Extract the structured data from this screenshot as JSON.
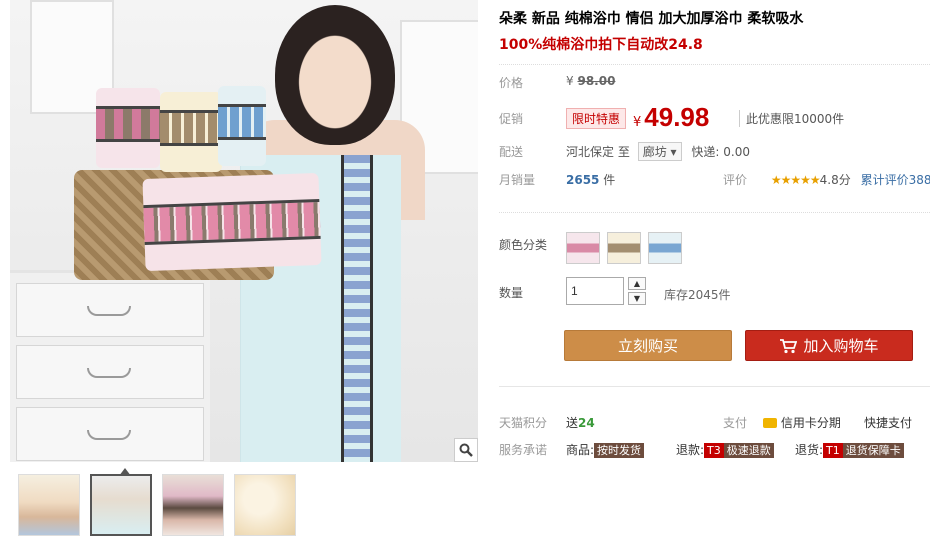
{
  "product": {
    "title": "朵柔 新品 纯棉浴巾 情侣 加大加厚浴巾 柔软吸水",
    "subtitle": "100%纯棉浴巾拍下自动改24.8"
  },
  "price": {
    "label": "价格",
    "currency": "¥",
    "original": "98.00"
  },
  "promo": {
    "label": "促销",
    "tag": "限时特惠",
    "currency": "¥",
    "price": "49.98",
    "limit": "此优惠限10000件"
  },
  "shipping": {
    "label": "配送",
    "from": "河北保定",
    "to_word": "至",
    "destination": "廊坊",
    "express": "快递: 0.00"
  },
  "sales": {
    "label": "月销量",
    "count": "2655",
    "unit": "件",
    "rating_label": "评价",
    "stars": "★★★★★",
    "score": "4.8分",
    "reviews": "累计评价388"
  },
  "color": {
    "label": "颜色分类",
    "swatches": [
      "pink-towel",
      "beige-towel",
      "blue-towel"
    ]
  },
  "quantity": {
    "label": "数量",
    "value": "1",
    "stock": "库存2045件"
  },
  "actions": {
    "buy_now": "立刻购买",
    "add_cart": "加入购物车"
  },
  "points": {
    "label": "天猫积分",
    "send": "送",
    "amount": "24",
    "pay_label": "支付",
    "credit": "信用卡分期",
    "quick": "快捷支付"
  },
  "service": {
    "label": "服务承诺",
    "goods": "商品:",
    "goods_tag": "按时发货",
    "refund": "退款:",
    "refund_code": "T3",
    "refund_tag": "极速退款",
    "return": "退货:",
    "return_code": "T1",
    "return_tag": "退货保障卡"
  },
  "colors": {
    "promo_red": "#c40000",
    "buy_button": "#cd8d48",
    "cart_button": "#c92b1e",
    "star": "#e8a000"
  }
}
